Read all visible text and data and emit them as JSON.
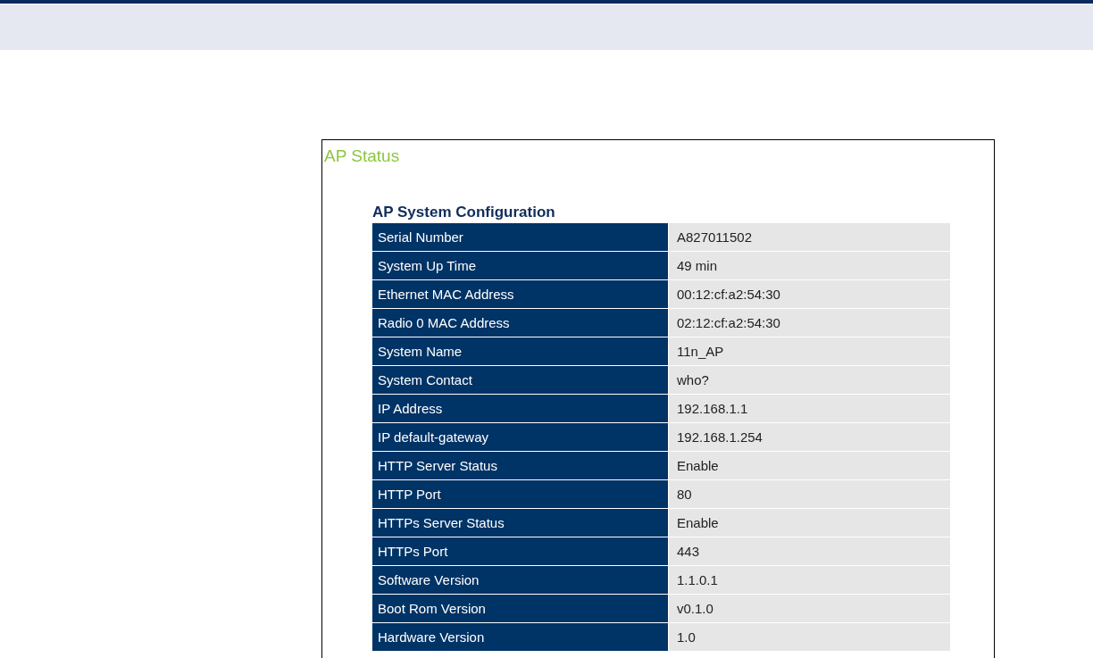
{
  "panel": {
    "title": "AP Status"
  },
  "section": {
    "heading": "AP System Configuration"
  },
  "table": {
    "rows": [
      {
        "label": "Serial Number",
        "value": "A827011502"
      },
      {
        "label": "System Up Time",
        "value": "49 min"
      },
      {
        "label": "Ethernet MAC Address",
        "value": "00:12:cf:a2:54:30"
      },
      {
        "label": "Radio 0 MAC Address",
        "value": "02:12:cf:a2:54:30"
      },
      {
        "label": "System Name",
        "value": "11n_AP"
      },
      {
        "label": "System Contact",
        "value": "who?"
      },
      {
        "label": "IP Address",
        "value": "192.168.1.1"
      },
      {
        "label": "IP default-gateway",
        "value": "192.168.1.254"
      },
      {
        "label": "HTTP Server Status",
        "value": "Enable"
      },
      {
        "label": "HTTP Port",
        "value": "80"
      },
      {
        "label": "HTTPs Server Status",
        "value": "Enable"
      },
      {
        "label": "HTTPs Port",
        "value": "443"
      },
      {
        "label": "Software Version",
        "value": "1.1.0.1"
      },
      {
        "label": "Boot Rom Version",
        "value": "v0.1.0"
      },
      {
        "label": "Hardware Version",
        "value": "1.0"
      }
    ]
  }
}
